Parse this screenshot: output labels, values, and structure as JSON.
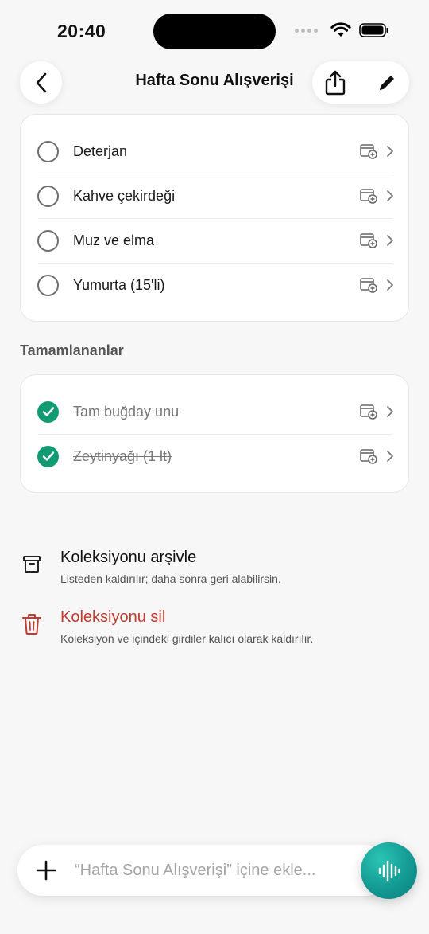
{
  "status_bar": {
    "time": "20:40"
  },
  "header": {
    "title": "Hafta Sonu Alışverişi"
  },
  "active_items": [
    {
      "label": "Deterjan"
    },
    {
      "label": "Kahve çekirdeği"
    },
    {
      "label": "Muz ve elma"
    },
    {
      "label": "Yumurta (15'li)"
    }
  ],
  "completed_section": {
    "title": "Tamamlananlar",
    "items": [
      {
        "label": "Tam buğday unu"
      },
      {
        "label": "Zeytinyağı (1 lt)"
      }
    ]
  },
  "collection_actions": {
    "archive": {
      "title": "Koleksiyonu arşivle",
      "subtitle": "Listeden kaldırılır; daha sonra geri alabilirsin."
    },
    "delete": {
      "title": "Koleksiyonu sil",
      "subtitle": "Koleksiyon ve içindeki girdiler kalıcı olarak kaldırılır."
    }
  },
  "add_bar": {
    "placeholder": "“Hafta Sonu Alışverişi” içine ekle..."
  },
  "colors": {
    "accent_green": "#129a73",
    "danger_red": "#c23b2e",
    "voice_teal": "#139a93"
  }
}
